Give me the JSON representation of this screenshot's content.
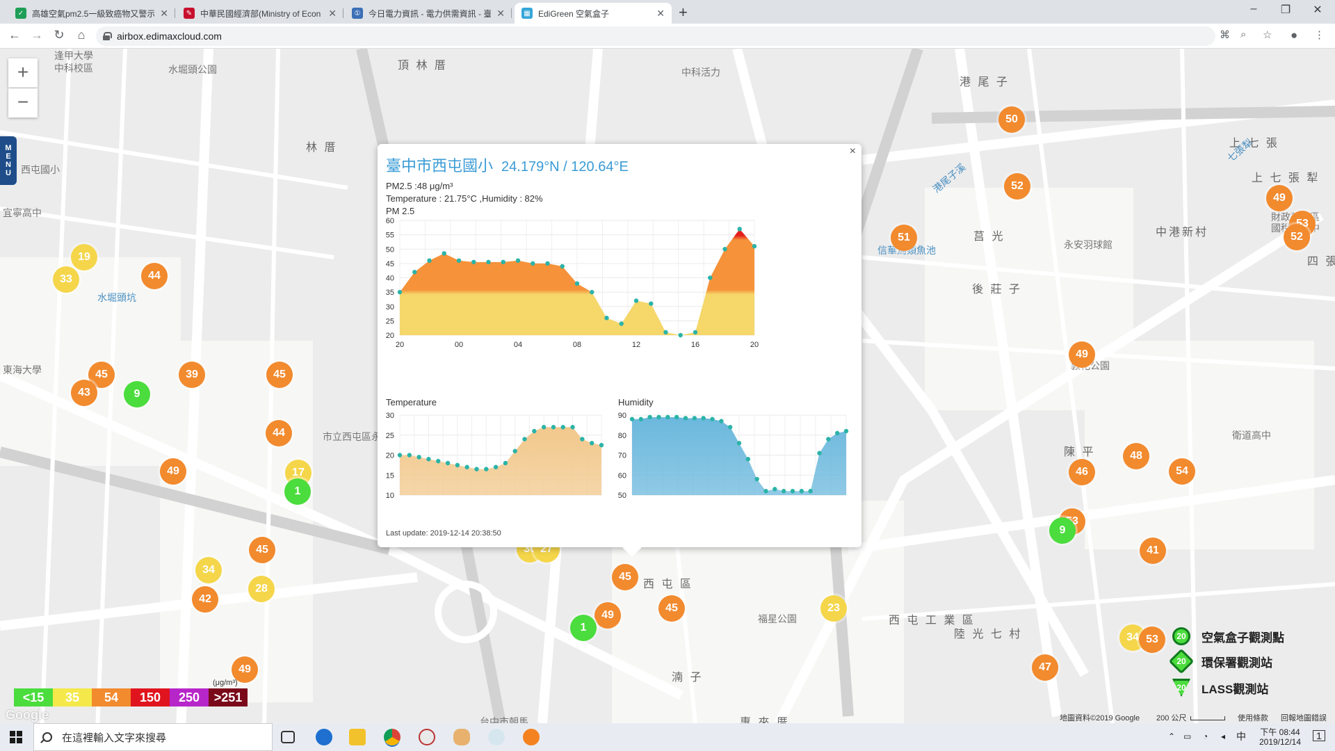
{
  "browser": {
    "tabs": [
      {
        "title": "高雄空氣pm2.5一級致癌物又警示",
        "favicon_color": "#1e9e56",
        "favicon_glyph": "✓"
      },
      {
        "title": "中華民國經濟部(Ministry of Econ",
        "favicon_color": "#c8102e",
        "favicon_glyph": "✎"
      },
      {
        "title": "今日電力資訊 - 電力供需資訊 - 臺",
        "favicon_color": "#3b6fb6",
        "favicon_glyph": "①"
      },
      {
        "title": "EdiGreen 空氣盒子",
        "favicon_color": "#35a6d8",
        "favicon_glyph": "▦"
      }
    ],
    "active_tab": 3,
    "url": "airbox.edimaxcloud.com",
    "window_controls": {
      "minimize": "–",
      "maximize": "❐",
      "close": "✕"
    }
  },
  "map": {
    "zoom_in": "+",
    "zoom_out": "−",
    "menu_label": [
      "M",
      "E",
      "N",
      "U"
    ],
    "place_labels": [
      {
        "text": "逢甲大學",
        "cls": ""
      },
      {
        "text": "中科校區",
        "cls": ""
      },
      {
        "text": "水堀頭公園",
        "cls": ""
      },
      {
        "text": "頂 林 厝",
        "cls": "big"
      },
      {
        "text": "中科活力",
        "cls": ""
      },
      {
        "text": "港 尾 子",
        "cls": "big"
      },
      {
        "text": "上 七 張",
        "cls": "big"
      },
      {
        "text": "上 七 張 犁",
        "cls": "big"
      },
      {
        "text": "財政部中區",
        "cls": ""
      },
      {
        "text": "國稅局臺中",
        "cls": ""
      },
      {
        "text": "林 厝",
        "cls": "big"
      },
      {
        "text": "西屯國小",
        "cls": ""
      },
      {
        "text": "宜寧高中",
        "cls": ""
      },
      {
        "text": "水堀頭坑",
        "cls": "blue"
      },
      {
        "text": "東海大學",
        "cls": ""
      },
      {
        "text": "中港新村",
        "cls": "big"
      },
      {
        "text": "四 張",
        "cls": "big"
      },
      {
        "text": "莒 光",
        "cls": "big"
      },
      {
        "text": "永安羽球館",
        "cls": ""
      },
      {
        "text": "後 莊 子",
        "cls": "big"
      },
      {
        "text": "信華鳥類魚池",
        "cls": "blue"
      },
      {
        "text": "港尾子溪",
        "cls": "blue"
      },
      {
        "text": "敦化公園",
        "cls": ""
      },
      {
        "text": "陳 平",
        "cls": "big"
      },
      {
        "text": "華 廈 新 村",
        "cls": "big"
      },
      {
        "text": "西 屯 區",
        "cls": "big"
      },
      {
        "text": "西 屯 工 業 區",
        "cls": "big"
      },
      {
        "text": "陸 光 七 村",
        "cls": "big"
      },
      {
        "text": "福科路",
        "cls": ""
      },
      {
        "text": "福星公園",
        "cls": ""
      },
      {
        "text": "湳 子",
        "cls": "big"
      },
      {
        "text": "惠 來 厝",
        "cls": "big"
      },
      {
        "text": "台中市朝馬",
        "cls": ""
      },
      {
        "text": "七張犁",
        "cls": "blue"
      },
      {
        "text": "衛道高中",
        "cls": ""
      },
      {
        "text": "市立西屯區永安國",
        "cls": ""
      }
    ],
    "markers": [
      {
        "v": "19",
        "c": "yellow"
      },
      {
        "v": "33",
        "c": "yellow"
      },
      {
        "v": "44",
        "c": "orange"
      },
      {
        "v": "45",
        "c": "orange"
      },
      {
        "v": "43",
        "c": "orange"
      },
      {
        "v": "9",
        "c": "green"
      },
      {
        "v": "39",
        "c": "orange"
      },
      {
        "v": "45",
        "c": "orange"
      },
      {
        "v": "44",
        "c": "orange"
      },
      {
        "v": "49",
        "c": "orange"
      },
      {
        "v": "17",
        "c": "yellow"
      },
      {
        "v": "1",
        "c": "green"
      },
      {
        "v": "45",
        "c": "orange"
      },
      {
        "v": "34",
        "c": "yellow"
      },
      {
        "v": "28",
        "c": "yellow"
      },
      {
        "v": "42",
        "c": "orange"
      },
      {
        "v": "49",
        "c": "orange"
      },
      {
        "v": "30",
        "c": "yellow"
      },
      {
        "v": "48",
        "c": "orange"
      },
      {
        "v": "30",
        "c": "yellow"
      },
      {
        "v": "27",
        "c": "yellow"
      },
      {
        "v": "45",
        "c": "orange"
      },
      {
        "v": "49",
        "c": "orange"
      },
      {
        "v": "1",
        "c": "green"
      },
      {
        "v": "45",
        "c": "orange"
      },
      {
        "v": "23",
        "c": "yellow"
      },
      {
        "v": "50",
        "c": "orange"
      },
      {
        "v": "52",
        "c": "orange"
      },
      {
        "v": "51",
        "c": "orange"
      },
      {
        "v": "49",
        "c": "orange"
      },
      {
        "v": "53",
        "c": "orange"
      },
      {
        "v": "52",
        "c": "orange"
      },
      {
        "v": "49",
        "c": "orange"
      },
      {
        "v": "48",
        "c": "orange"
      },
      {
        "v": "46",
        "c": "orange"
      },
      {
        "v": "54",
        "c": "orange"
      },
      {
        "v": "53",
        "c": "orange"
      },
      {
        "v": "9",
        "c": "green"
      },
      {
        "v": "41",
        "c": "orange"
      },
      {
        "v": "34",
        "c": "yellow"
      },
      {
        "v": "53",
        "c": "orange"
      },
      {
        "v": "47",
        "c": "orange"
      }
    ],
    "aqi_legend": {
      "unit": "(μg/m³)",
      "levels": [
        {
          "label": "<15",
          "color": "#4bdc3d"
        },
        {
          "label": "35",
          "color": "#f5e84a"
        },
        {
          "label": "54",
          "color": "#f28a2e"
        },
        {
          "label": "150",
          "color": "#e0141e"
        },
        {
          "label": "250",
          "color": "#b726c9"
        },
        {
          "label": ">251",
          "color": "#7a0a1a"
        }
      ]
    },
    "station_legend": [
      {
        "label": "空氣盒子觀測點",
        "badge": "20"
      },
      {
        "label": "環保署觀測站",
        "badge": "20"
      },
      {
        "label": "LASS觀測站",
        "badge": "20"
      }
    ],
    "footer": {
      "attribution": "地圖資料©2019 Google",
      "scale": "200 公尺",
      "terms": "使用條款",
      "report": "回報地圖錯誤",
      "google": "Google"
    }
  },
  "popup": {
    "close": "×",
    "site_name": "臺中市西屯國小",
    "coords": "24.179°N / 120.64°E",
    "pm25_line": "PM2.5 :48 μg/m³",
    "temp_line": "Temperature : 21.75°C ,Humidity : 82%",
    "last_update": "Last update: 2019-12-14 20:38:50"
  },
  "chart_data": [
    {
      "type": "area",
      "title": "PM 2.5",
      "x_tick_labels": [
        "20",
        "00",
        "04",
        "08",
        "12",
        "16",
        "20"
      ],
      "ylim": [
        20,
        60
      ],
      "y_ticks": [
        20,
        25,
        30,
        35,
        40,
        45,
        50,
        55,
        60
      ],
      "grid": true,
      "values": [
        35,
        42,
        46,
        48.5,
        46,
        45.5,
        45.5,
        45.5,
        46,
        45,
        45,
        44,
        38,
        35,
        26,
        24,
        32,
        31,
        21,
        20,
        21,
        40,
        50,
        57,
        51
      ],
      "color_bands": [
        {
          "from": 20,
          "to": 35,
          "color": "#f5d76a"
        },
        {
          "from": 35,
          "to": 54,
          "color": "#f5923a"
        },
        {
          "from": 54,
          "to": 60,
          "color": "#e4201e"
        }
      ],
      "point_color": "#2bb3a8"
    },
    {
      "type": "area",
      "title": "Temperature",
      "ylim": [
        10,
        30
      ],
      "y_ticks": [
        10,
        15,
        20,
        25,
        30
      ],
      "grid": true,
      "values": [
        20,
        20,
        19.5,
        19,
        18.5,
        18,
        17.5,
        17,
        16.5,
        16.5,
        17,
        18,
        21,
        24,
        26,
        27,
        27,
        27,
        27,
        24,
        23,
        22.5
      ],
      "fill_color": "#f2c88c",
      "point_color": "#2bb3a8"
    },
    {
      "type": "area",
      "title": "Humidity",
      "ylim": [
        50,
        90
      ],
      "y_ticks": [
        50,
        60,
        70,
        80,
        90
      ],
      "grid": true,
      "values": [
        88,
        88,
        89,
        89,
        89,
        89,
        88.5,
        88.5,
        88.5,
        88,
        87,
        84,
        76,
        68,
        58,
        52,
        53,
        52,
        52,
        52,
        52,
        71,
        78,
        81,
        82
      ],
      "fill_color": "#6bb8dd",
      "point_color": "#2bb3a8"
    }
  ],
  "taskbar": {
    "search_placeholder": "在這裡輸入文字來搜尋",
    "time_prefix": "下午",
    "time": "08:44",
    "date": "2019/12/14",
    "ime": "中",
    "notification_count": "1"
  }
}
